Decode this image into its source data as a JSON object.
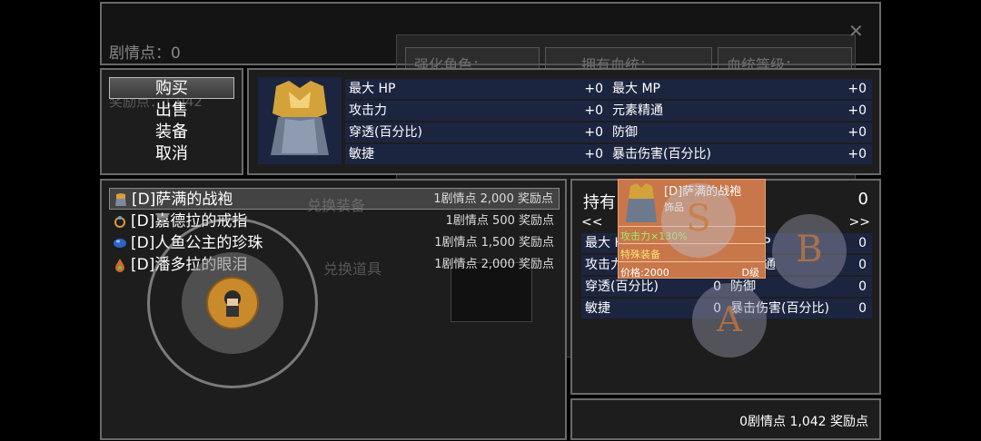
{
  "background": {
    "story_points": "剧情点：0",
    "reward_points": "奖励点：1,042",
    "strengthen_tab": "强化角色：",
    "ability_tab": "拥有血统：",
    "bloodline_tab": "血统等级：",
    "exchange_equip": "兑换装备",
    "exchange_item": "兑换道具"
  },
  "menu": {
    "items": [
      {
        "label": "购买",
        "selected": true
      },
      {
        "label": "出售",
        "selected": false
      },
      {
        "label": "装备",
        "selected": false
      },
      {
        "label": "取消",
        "selected": false
      }
    ]
  },
  "stats": {
    "left": [
      {
        "label": "最大 HP",
        "value": "+0"
      },
      {
        "label": "攻击力",
        "value": "+0"
      },
      {
        "label": "穿透(百分比)",
        "value": "+0"
      },
      {
        "label": "敏捷",
        "value": "+0"
      }
    ],
    "right": [
      {
        "label": "最大 MP",
        "value": "+0"
      },
      {
        "label": "元素精通",
        "value": "+0"
      },
      {
        "label": "防御",
        "value": "+0"
      },
      {
        "label": "暴击伤害(百分比)",
        "value": "+0"
      }
    ]
  },
  "shop_list": [
    {
      "name": "[D]萨满的战袍",
      "price": "1剧情点  2,000 奖励点",
      "icon": "robe-icon",
      "selected": true
    },
    {
      "name": "[D]嘉德拉的戒指",
      "price": "1剧情点   500 奖励点",
      "icon": "ring-icon",
      "selected": false
    },
    {
      "name": "[D]人鱼公主的珍珠",
      "price": "1剧情点  1,500 奖励点",
      "icon": "pearl-icon",
      "selected": false
    },
    {
      "name": "[D]潘多拉的眼泪",
      "price": "1剧情点  2,000 奖励点",
      "icon": "tear-icon",
      "selected": false
    }
  ],
  "holding": {
    "label": "持有",
    "count": "0",
    "prev": "<<",
    "next": ">>",
    "left": [
      {
        "label": "最大 H",
        "value": ""
      },
      {
        "label": "攻击力",
        "value": ""
      },
      {
        "label": "穿透(百分比)",
        "value": "0"
      },
      {
        "label": "敏捷",
        "value": "0"
      }
    ],
    "right": [
      {
        "label": "P",
        "value": "0"
      },
      {
        "label": "通",
        "value": "0"
      },
      {
        "label": "防御",
        "value": "0"
      },
      {
        "label": "暴击伤害(百分比)",
        "value": "0"
      }
    ]
  },
  "tooltip": {
    "title": "[D]萨满的战袍",
    "category": "饰品",
    "bonus": "攻击力×130%",
    "special": "特殊装备",
    "price": "价格:2000",
    "grade": "D级"
  },
  "footer": {
    "balance": "0剧情点  1,042 奖励点"
  },
  "controls": {
    "button_a": "A",
    "button_b": "B",
    "button_s": "S",
    "close": "✕"
  },
  "colors": {
    "panel_bg": "#1d1d1d",
    "panel_border": "#6a6a6a",
    "stat_row_bg": "#1c2540",
    "tooltip_bg": "#c8774a",
    "button_letter": "#c8783c"
  }
}
